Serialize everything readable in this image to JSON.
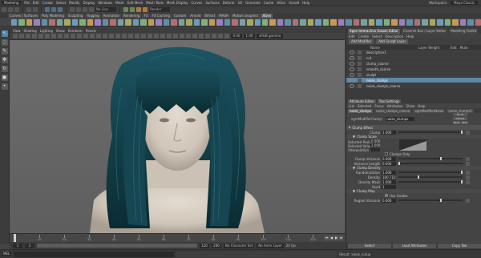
{
  "menubar": {
    "mode": "Modeling",
    "items": [
      "File",
      "Edit",
      "Create",
      "Select",
      "Modify",
      "Display",
      "Windows",
      "Mesh",
      "Edit Mesh",
      "Mesh Tools",
      "Mesh Display",
      "Curves",
      "Surfaces",
      "Deform",
      "UV",
      "Generate",
      "Cache",
      "XGen",
      "Arnold",
      "Help"
    ],
    "workspace_label": "Workspace:",
    "workspace": "Maya Classic"
  },
  "status": {
    "field_value": "No Live Surface",
    "render_field": "Render"
  },
  "shelf_tabs": [
    "Curves / Surfaces",
    "Poly Modeling",
    "Sculpting",
    "Rigging",
    "Animation",
    "Rendering",
    "FX",
    "FX Caching",
    "Custom",
    "Arnold",
    "Bifrost",
    "MASH",
    "Motion Graphics",
    "XGen"
  ],
  "shelf_active_tab": "XGen",
  "viewport": {
    "menu": [
      "View",
      "Shading",
      "Lighting",
      "Show",
      "Renderer",
      "Panels"
    ],
    "exposure": "0.00",
    "gamma": "1.00",
    "colorspace": "sRGB gamma"
  },
  "timeline": {
    "ticks": [
      "1",
      "10",
      "20",
      "30",
      "40",
      "50",
      "60",
      "70",
      "80",
      "90",
      "100",
      "110",
      "120"
    ],
    "current_frame": "1",
    "range_start": "1",
    "range_start_inner": "1",
    "range_end_inner": "120",
    "range_end": "200",
    "character_set": "No Character Set",
    "anim_layer": "No Anim Layer",
    "fps": "24 fps"
  },
  "cmd": {
    "lang": "MEL",
    "result": "Result: xlook_cutup"
  },
  "layer_editor": {
    "tabs": [
      "Xgen Interactive Groom Editor",
      "Channel Box / Layer Editor",
      "Modeling Toolkit"
    ],
    "menu": [
      "Edit",
      "Create",
      "Select",
      "Description",
      "Help"
    ],
    "toolbar_add": "Add Modifier",
    "toolbar_add2": "Add Sculpt Layer",
    "columns": [
      "Name",
      "Layer Weight",
      "Edit",
      "Mute"
    ],
    "layers": [
      {
        "name": "description1",
        "selected": false
      },
      {
        "name": "cut",
        "selected": false
      },
      {
        "name": "clump_coarse",
        "selected": false
      },
      {
        "name": "smooth_coarse",
        "selected": false
      },
      {
        "name": "sculpt",
        "selected": false
      },
      {
        "name": "noise_clumps",
        "selected": true
      },
      {
        "name": "noise_clumps_coarse",
        "selected": false
      }
    ]
  },
  "attr_editor": {
    "head_tabs": [
      "Attribute Editor",
      "Tool Settings"
    ],
    "menu": [
      "List",
      "Selected",
      "Focus",
      "Attributes",
      "Show",
      "Help"
    ],
    "node_tabs": [
      "noise_clumps",
      "noise_clumps_coarse",
      "xgmModifierNoise",
      "noise_clumps1"
    ],
    "node_label": "xgmModifierClump:",
    "node_value": "noise_clumps",
    "side_buttons": [
      "Focus",
      "Presets",
      "Show",
      "Hide"
    ],
    "sections": {
      "clump_effect": "Clump Effect",
      "clump_scale": "Clump Scale",
      "clump_density": "Clump Density",
      "clump_map": "Clump Map"
    },
    "attrs": {
      "clump_value": "1.000",
      "clump_label": "Clump",
      "selected_position_label": "Selected Position",
      "selected_position": "0.000",
      "selected_value_label": "Selected Value",
      "selected_value": "1.000",
      "interpolation_label": "Interpolation",
      "clumps_only_label": "Clumps Only",
      "scale_variance_label": "Clump Variance",
      "scale_variance": "0.000",
      "variance_length_label": "Variance Length",
      "variance_length": "0.000",
      "randomization_label": "Randomization",
      "randomization": "1.000",
      "density_label": "Density",
      "density": "100.710",
      "density_mask_label": "Density Mask",
      "density_mask": "1.000",
      "seed_label": "Seed",
      "seed": "1",
      "use_guides_label": "Use Guides",
      "region_variance_label": "Region Variance",
      "region_variance": "0.000"
    },
    "bottom_buttons": [
      "Select",
      "Load Attributes",
      "Copy Tab"
    ]
  },
  "colors": {
    "hair": "#123c45",
    "skin": "#d8cfc4",
    "selected": "#5d88a8"
  }
}
